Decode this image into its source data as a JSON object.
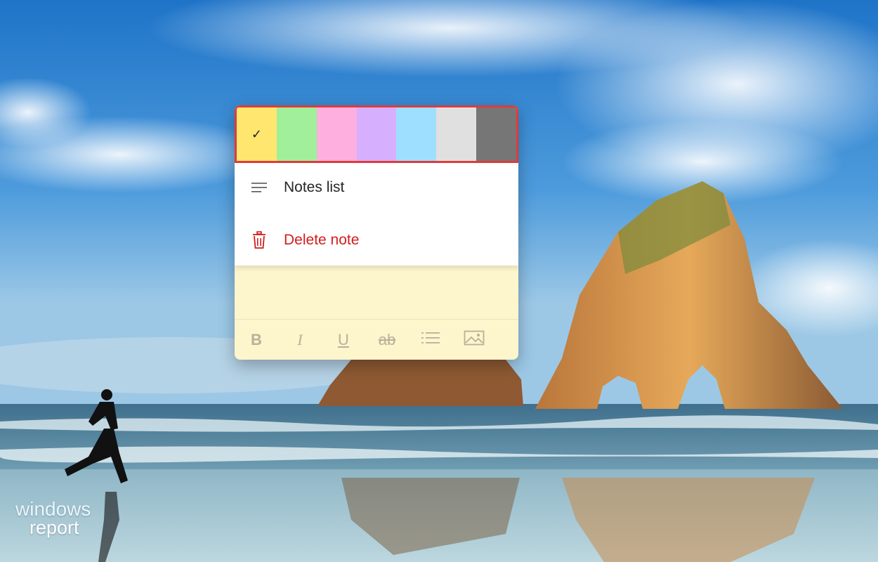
{
  "note": {
    "color_palette": [
      {
        "name": "yellow",
        "color": "#ffe66e",
        "selected": true
      },
      {
        "name": "green",
        "color": "#a1ef9b",
        "selected": false
      },
      {
        "name": "pink",
        "color": "#ffafdf",
        "selected": false
      },
      {
        "name": "purple",
        "color": "#d7afff",
        "selected": false
      },
      {
        "name": "blue",
        "color": "#9edfff",
        "selected": false
      },
      {
        "name": "gray",
        "color": "#e0e0e0",
        "selected": false
      },
      {
        "name": "charcoal",
        "color": "#767676",
        "selected": false
      }
    ],
    "selected_check": "✓",
    "menu": {
      "notes_list_label": "Notes list",
      "notes_list_icon": "notes-list-icon",
      "delete_label": "Delete note",
      "delete_icon": "trash-icon",
      "delete_color": "#d11d1d"
    },
    "toolbar": {
      "bold": "B",
      "italic": "I",
      "underline": "U",
      "strikethrough": "ab",
      "bullets_icon": "bullet-list-icon",
      "image_icon": "image-icon"
    },
    "accent_border": "#e03a3a",
    "body_color": "#fdf5cc"
  },
  "watermark": {
    "line1": "windows",
    "line2": "report"
  }
}
